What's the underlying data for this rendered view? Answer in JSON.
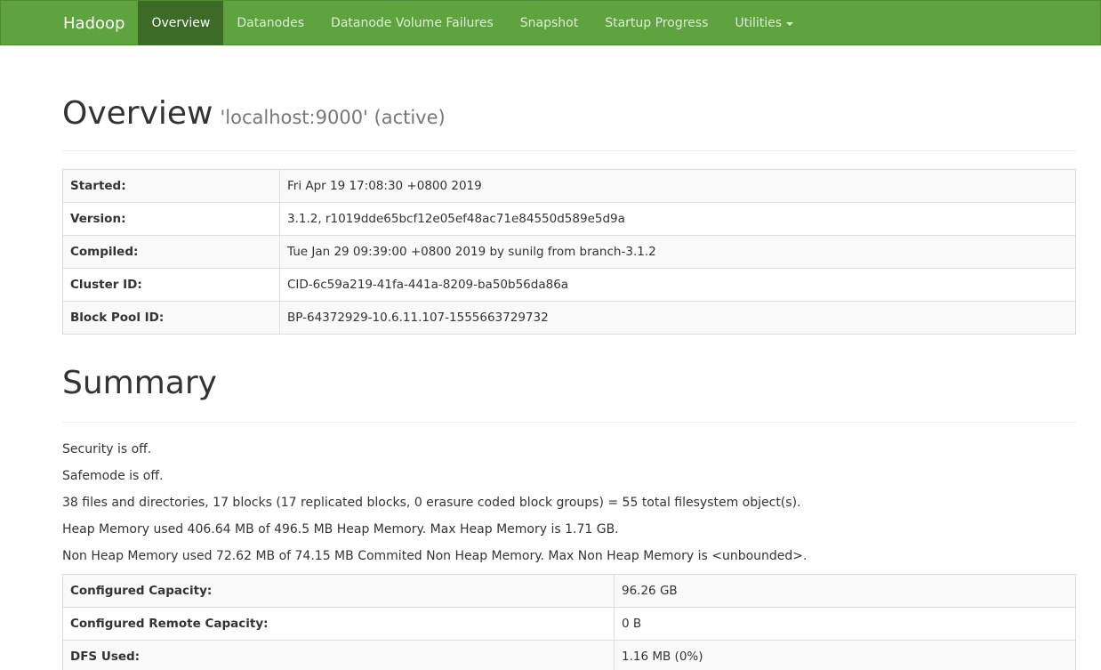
{
  "navbar": {
    "brand": "Hadoop",
    "items": [
      {
        "label": "Overview"
      },
      {
        "label": "Datanodes"
      },
      {
        "label": "Datanode Volume Failures"
      },
      {
        "label": "Snapshot"
      },
      {
        "label": "Startup Progress"
      },
      {
        "label": "Utilities"
      }
    ]
  },
  "overview": {
    "title": "Overview",
    "subtitle": "'localhost:9000' (active)",
    "rows": [
      {
        "key": "Started:",
        "value": "Fri Apr 19 17:08:30 +0800 2019"
      },
      {
        "key": "Version:",
        "value": "3.1.2, r1019dde65bcf12e05ef48ac71e84550d589e5d9a"
      },
      {
        "key": "Compiled:",
        "value": "Tue Jan 29 09:39:00 +0800 2019 by sunilg from branch-3.1.2"
      },
      {
        "key": "Cluster ID:",
        "value": "CID-6c59a219-41fa-441a-8209-ba50b56da86a"
      },
      {
        "key": "Block Pool ID:",
        "value": "BP-64372929-10.6.11.107-1555663729732"
      }
    ]
  },
  "summary": {
    "title": "Summary",
    "lines": [
      "Security is off.",
      "Safemode is off.",
      "38 files and directories, 17 blocks (17 replicated blocks, 0 erasure coded block groups) = 55 total filesystem object(s).",
      "Heap Memory used 406.64 MB of 496.5 MB Heap Memory. Max Heap Memory is 1.71 GB.",
      "Non Heap Memory used 72.62 MB of 74.15 MB Commited Non Heap Memory. Max Non Heap Memory is <unbounded>."
    ],
    "rows": [
      {
        "key": "Configured Capacity:",
        "value": "96.26 GB"
      },
      {
        "key": "Configured Remote Capacity:",
        "value": "0 B"
      },
      {
        "key": "DFS Used:",
        "value": "1.16 MB (0%)"
      }
    ]
  },
  "icons": {
    "utilities_menu": "chevron-down-icon"
  },
  "colors": {
    "navbar": "#5fa33e",
    "navbar_active": "#3c6b27"
  }
}
